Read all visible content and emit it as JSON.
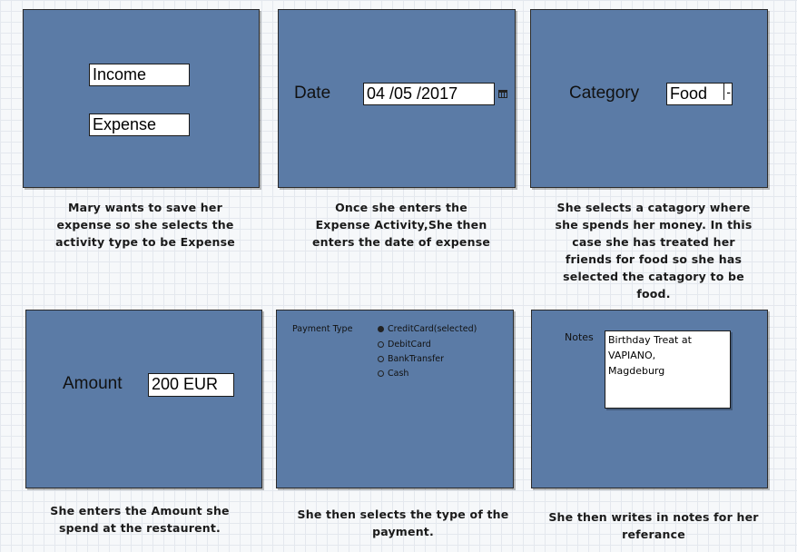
{
  "panel1": {
    "income": "Income",
    "expense": "Expense",
    "caption": [
      "Mary wants to save her",
      "expense so she selects the",
      "activity type to be Expense"
    ]
  },
  "panel2": {
    "date_label": "Date",
    "date_value": "04 /05 /2017",
    "caption": [
      "Once she enters the",
      "Expense Activity,She then",
      "enters the date of expense"
    ]
  },
  "panel3": {
    "category_label": "Category",
    "category_value": "Food",
    "dropdown_glyph": "-",
    "caption": [
      "She selects a catagory where",
      "she spends her money. In this",
      "case she has treated her",
      "friends for food so she has",
      "selected the catagory to be",
      "food."
    ]
  },
  "panel4": {
    "amount_label": "Amount",
    "amount_value": "200 EUR",
    "caption": [
      "She enters the Amount she",
      "spend at the restaurent."
    ]
  },
  "panel5": {
    "payment_label": "Payment Type",
    "options": [
      "CreditCard(selected)",
      "DebitCard",
      "BankTransfer",
      "Cash"
    ],
    "selected_index": 0,
    "caption": [
      "She then selects the type of the",
      "payment."
    ]
  },
  "panel6": {
    "notes_label": "Notes",
    "notes_lines": [
      "Birthday Treat at",
      "VAPIANO,",
      "Magdeburg"
    ],
    "caption": [
      "She then writes in notes for her",
      "referance"
    ]
  },
  "colors": {
    "panel": "#5b7ba6",
    "border": "#2b2b2b",
    "field": "#ffffff"
  }
}
